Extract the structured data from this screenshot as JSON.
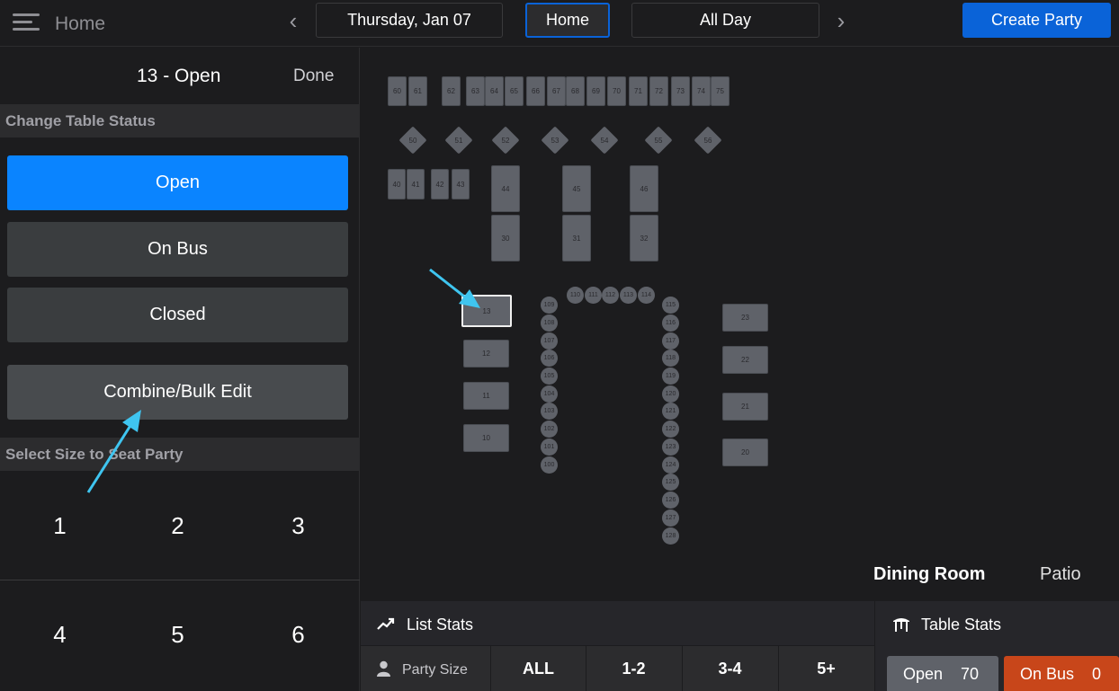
{
  "header": {
    "home_label": "Home",
    "date_label": "Thursday, Jan 07",
    "view_label": "Home",
    "shift_label": "All Day",
    "create_label": "Create Party"
  },
  "panel": {
    "title": "13 - Open",
    "done_label": "Done",
    "change_status_header": "Change Table Status",
    "status_buttons": [
      "Open",
      "On Bus",
      "Closed"
    ],
    "combine_label": "Combine/Bulk Edit",
    "size_header": "Select Size to Seat Party",
    "sizes": [
      "1",
      "2",
      "3",
      "4",
      "5",
      "6"
    ]
  },
  "floor": {
    "top_row": [
      "60",
      "61",
      "62",
      "63",
      "64",
      "65",
      "66",
      "67",
      "68",
      "69",
      "70",
      "71",
      "72",
      "73",
      "74",
      "75"
    ],
    "diamonds": [
      "50",
      "51",
      "52",
      "53",
      "54",
      "55",
      "56"
    ],
    "small_tables": [
      "40",
      "41",
      "42",
      "43"
    ],
    "long_tables_top": [
      "44",
      "45",
      "46"
    ],
    "long_tables_bottom": [
      "30",
      "31",
      "32"
    ],
    "left_column": [
      "13",
      "12",
      "11",
      "10"
    ],
    "right_column": [
      "23",
      "22",
      "21",
      "20"
    ],
    "bar_top": [
      "110",
      "111",
      "112",
      "113",
      "114"
    ],
    "bar_left": [
      "109",
      "108",
      "107",
      "106",
      "105",
      "104",
      "103",
      "102",
      "101",
      "100"
    ],
    "bar_right": [
      "115",
      "116",
      "117",
      "118",
      "119",
      "120",
      "121",
      "122",
      "123",
      "124",
      "125",
      "126",
      "127",
      "128"
    ],
    "rooms": [
      "Dining Room",
      "Patio"
    ]
  },
  "list_stats": {
    "title": "List Stats",
    "party_size_label": "Party Size",
    "filters": [
      "ALL",
      "1-2",
      "3-4",
      "5+"
    ]
  },
  "table_stats": {
    "title": "Table Stats",
    "open_label": "Open",
    "open_count": "70",
    "onbus_label": "On Bus",
    "onbus_count": "0"
  },
  "colors": {
    "accent": "#0a84ff",
    "primary_button": "#0a63d8",
    "on_bus": "#c8461a",
    "table_fill": "#5f6269",
    "annotation_arrow": "#3fc5f0"
  }
}
